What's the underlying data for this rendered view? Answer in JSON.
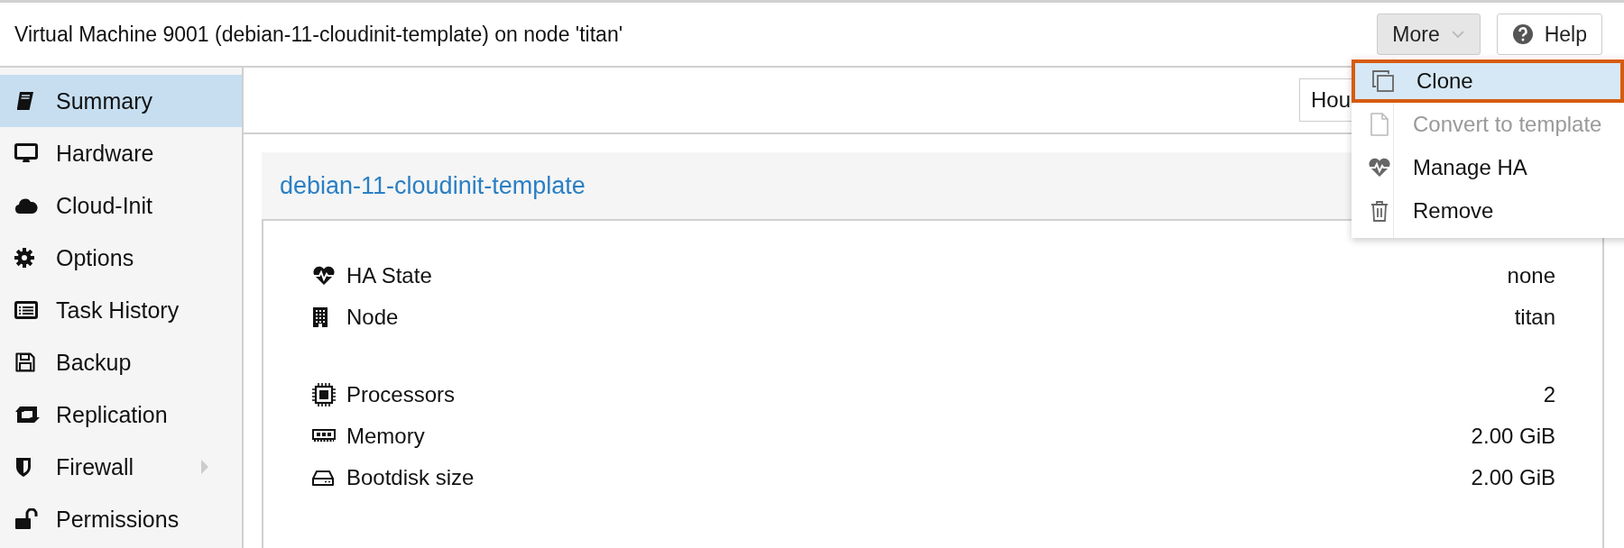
{
  "window": {
    "title": "Virtual Machine 9001 (debian-11-cloudinit-template) on node 'titan'"
  },
  "header_buttons": {
    "more": "More",
    "help": "Help"
  },
  "sidebar": {
    "items": [
      {
        "label": "Summary",
        "selected": true,
        "kind": "item"
      },
      {
        "label": "Hardware",
        "selected": false,
        "kind": "item"
      },
      {
        "label": "Cloud-Init",
        "selected": false,
        "kind": "item"
      },
      {
        "label": "Options",
        "selected": false,
        "kind": "item"
      },
      {
        "label": "Task History",
        "selected": false,
        "kind": "item"
      },
      {
        "label": "Backup",
        "selected": false,
        "kind": "item"
      },
      {
        "label": "Replication",
        "selected": false,
        "kind": "item"
      },
      {
        "label": "Firewall",
        "selected": false,
        "kind": "group"
      },
      {
        "label": "Permissions",
        "selected": false,
        "kind": "item"
      }
    ]
  },
  "toolbar": {
    "timeframe_value": "Hou"
  },
  "panel": {
    "title": "debian-11-cloudinit-template",
    "rows": [
      {
        "label": "HA State",
        "value": "none"
      },
      {
        "label": "Node",
        "value": "titan"
      },
      {
        "kind": "spacer"
      },
      {
        "label": "Processors",
        "value": "2"
      },
      {
        "label": "Memory",
        "value": "2.00 GiB"
      },
      {
        "label": "Bootdisk size",
        "value": "2.00 GiB"
      }
    ]
  },
  "more_menu": {
    "items": [
      {
        "label": "Clone",
        "selected": true,
        "disabled": false
      },
      {
        "label": "Convert to template",
        "selected": false,
        "disabled": true
      },
      {
        "label": "Manage HA",
        "selected": false,
        "disabled": false
      },
      {
        "label": "Remove",
        "selected": false,
        "disabled": false
      }
    ]
  }
}
